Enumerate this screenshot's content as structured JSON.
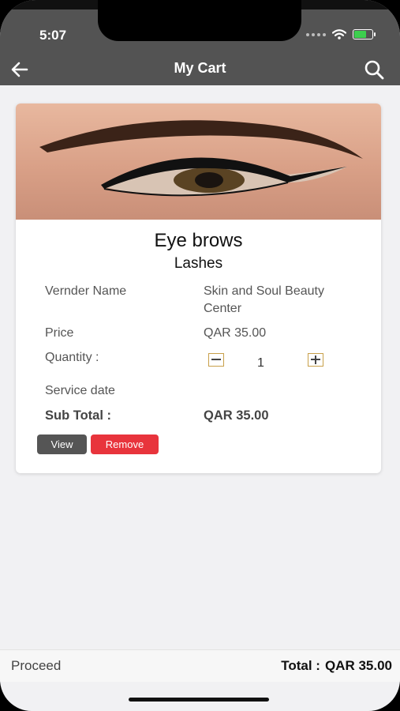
{
  "status_bar": {
    "time": "5:07",
    "icons": [
      "signal-dots-icon",
      "wifi-icon",
      "battery-icon"
    ]
  },
  "header": {
    "title": "My Cart",
    "back_icon": "arrow-left-icon",
    "search_icon": "search-icon"
  },
  "cart_item": {
    "image_icon": "eye-makeup-photo",
    "title": "Eye brows",
    "subtitle": "Lashes",
    "vendor_label": "Vernder Name",
    "vendor_value": "Skin and Soul Beauty Center",
    "price_label": "Price",
    "price_value": "QAR 35.00",
    "quantity_label": "Quantity :",
    "quantity_value": "1",
    "service_date_label": "Service date",
    "service_date_value": "",
    "subtotal_label": "Sub Total :",
    "subtotal_value": "QAR 35.00",
    "view_label": "View",
    "remove_label": "Remove"
  },
  "footer": {
    "proceed_label": "Proceed",
    "total_label": "Total :",
    "total_value": "QAR 35.00"
  },
  "colors": {
    "header_bg": "#535353",
    "remove_button": "#e8343c",
    "view_button": "#555555",
    "stepper_border": "#c8a04a"
  }
}
